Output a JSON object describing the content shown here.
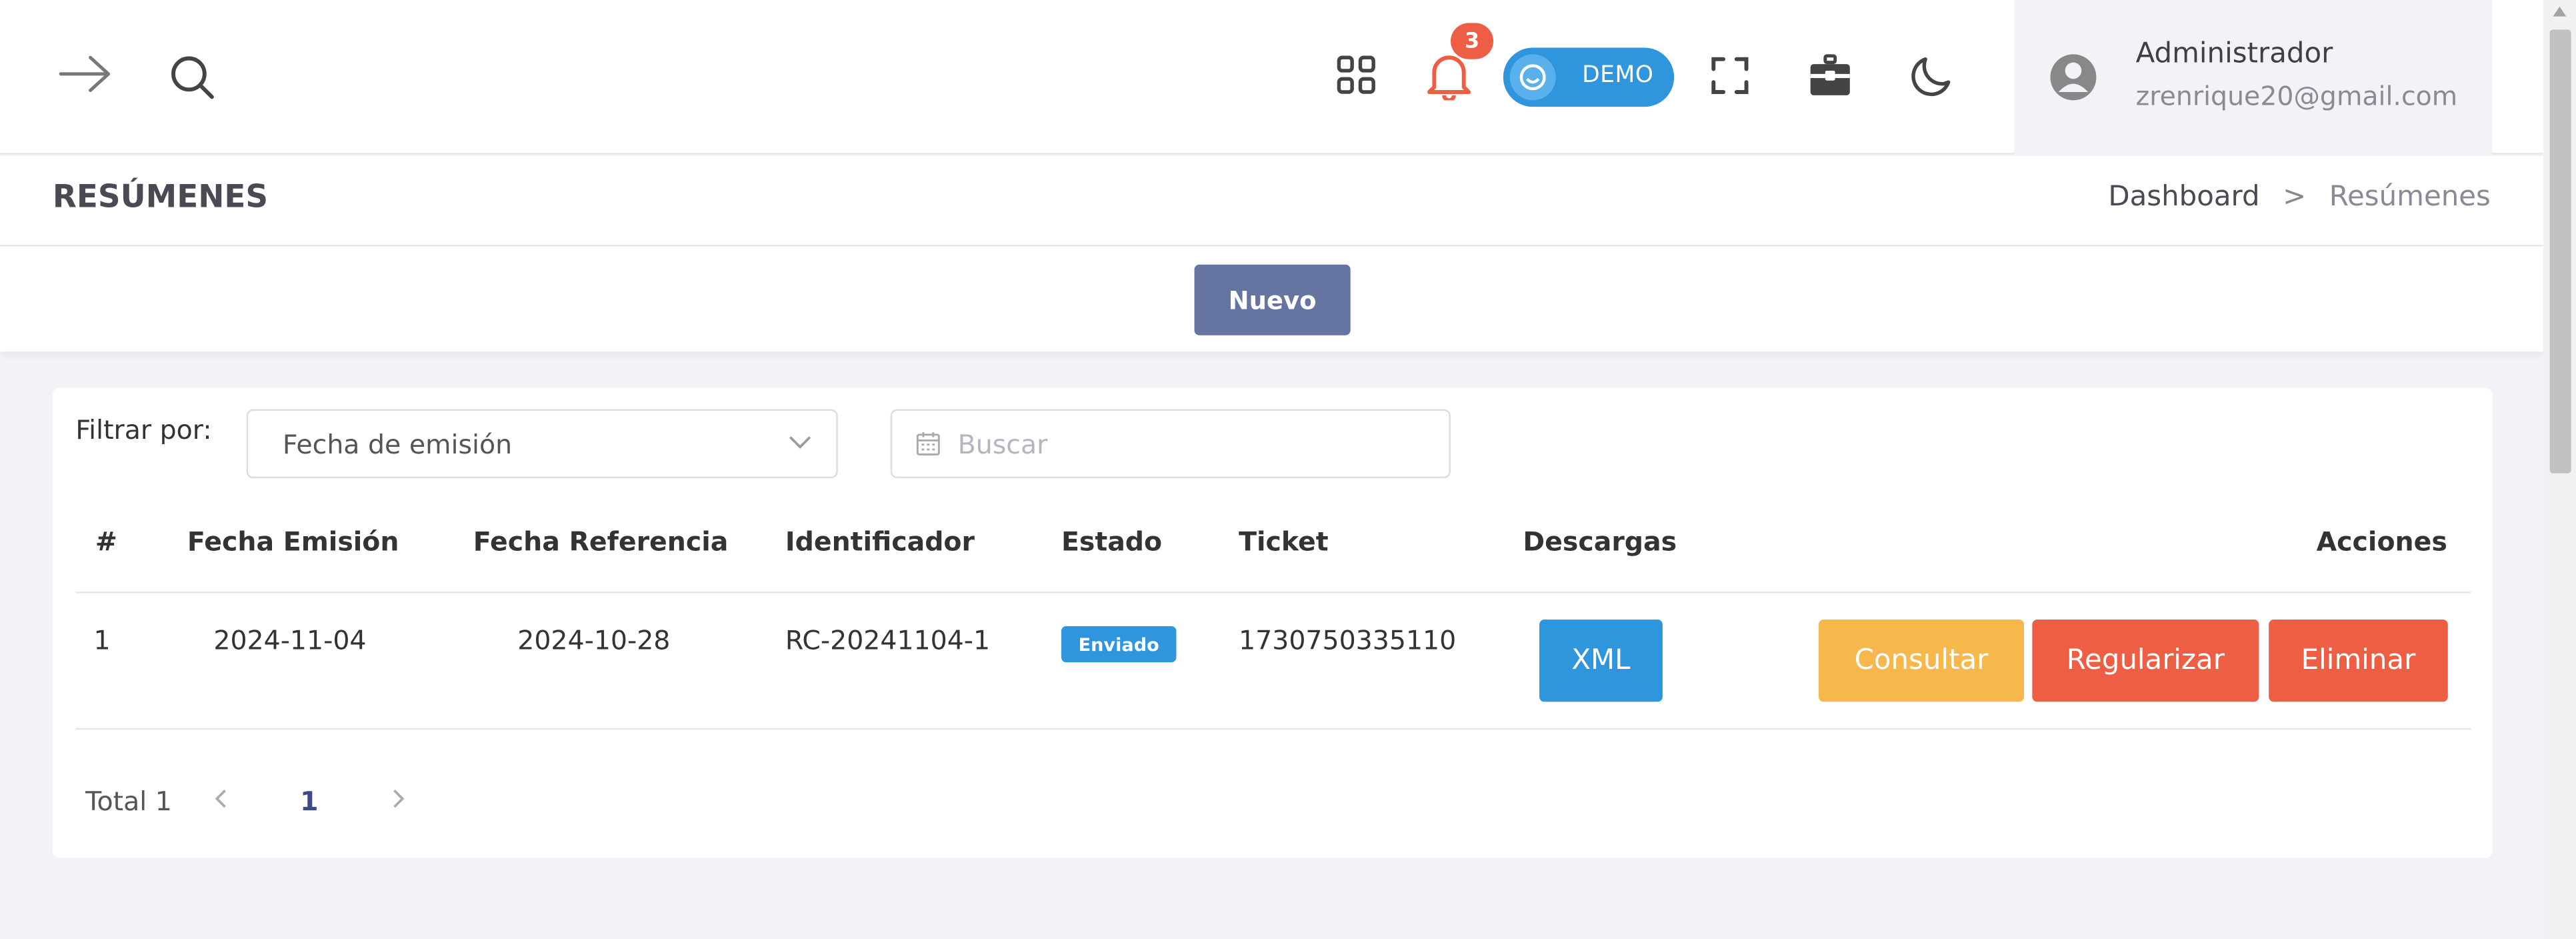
{
  "header": {
    "notifications_count": "3",
    "demo_label": "DEMO",
    "user": {
      "name": "Administrador",
      "email": "zrenrique20@gmail.com"
    }
  },
  "page": {
    "title": "RESÚMENES",
    "breadcrumb": [
      "Dashboard",
      "Resúmenes"
    ],
    "breadcrumb_sep": ">"
  },
  "toolbar": {
    "new_label": "Nuevo"
  },
  "filter": {
    "label": "Filtrar por:",
    "selected": "Fecha de emisión",
    "search_placeholder": "Buscar"
  },
  "table": {
    "columns": [
      "#",
      "Fecha Emisión",
      "Fecha Referencia",
      "Identificador",
      "Estado",
      "Ticket",
      "Descargas",
      "Acciones"
    ],
    "rows": [
      {
        "num": "1",
        "fecha_emision": "2024-11-04",
        "fecha_referencia": "2024-10-28",
        "identificador": "RC-20241104-1",
        "estado": "Enviado",
        "ticket": "1730750335110",
        "descarga": "XML",
        "actions": [
          "Consultar",
          "Regularizar",
          "Eliminar"
        ]
      }
    ]
  },
  "pagination": {
    "total_label": "Total 1",
    "current_page": "1"
  },
  "colors": {
    "primary": "#6674a2",
    "info": "#2f95dc",
    "warning": "#f6b84a",
    "danger": "#ee5e45"
  }
}
